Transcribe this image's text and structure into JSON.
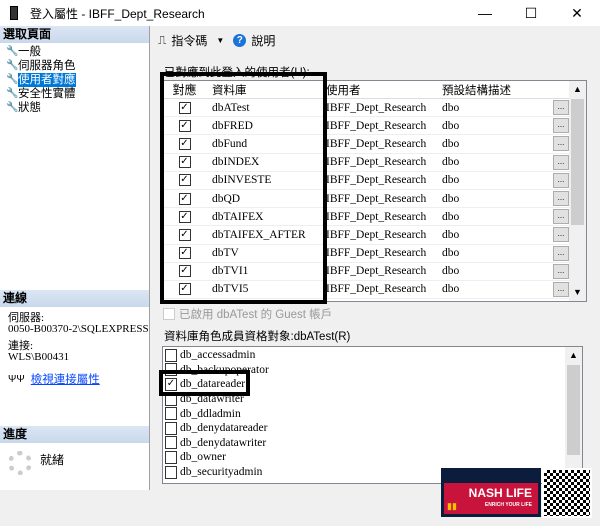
{
  "window": {
    "title": "登入屬性 - IBFF_Dept_Research"
  },
  "left": {
    "select_page_header": "選取頁面",
    "pages": [
      {
        "label": "一般"
      },
      {
        "label": "伺服器角色"
      },
      {
        "label": "使用者對應",
        "selected": true
      },
      {
        "label": "安全性實體"
      },
      {
        "label": "狀態"
      }
    ],
    "connection_header": "連線",
    "server_label": "伺服器:",
    "server_value": "0050-B00370-2\\SQLEXPRESS",
    "connection_label": "連接:",
    "connection_value": "WLS\\B00431",
    "view_connection_link": "檢視連接屬性",
    "progress_header": "進度",
    "progress_status": "就緒"
  },
  "toolbar": {
    "script_label": "指令碼",
    "help_label": "說明"
  },
  "users_mapped": {
    "label": "已對應到此登入的使用者(U):",
    "columns": [
      "對應",
      "資料庫",
      "使用者",
      "預設結構描述"
    ],
    "rows": [
      {
        "map": true,
        "db": "dbATest",
        "user": "IBFF_Dept_Research",
        "schema": "dbo"
      },
      {
        "map": true,
        "db": "dbFRED",
        "user": "IBFF_Dept_Research",
        "schema": "dbo"
      },
      {
        "map": true,
        "db": "dbFund",
        "user": "IBFF_Dept_Research",
        "schema": "dbo"
      },
      {
        "map": true,
        "db": "dbINDEX",
        "user": "IBFF_Dept_Research",
        "schema": "dbo"
      },
      {
        "map": true,
        "db": "dbINVESTE",
        "user": "IBFF_Dept_Research",
        "schema": "dbo"
      },
      {
        "map": true,
        "db": "dbQD",
        "user": "IBFF_Dept_Research",
        "schema": "dbo"
      },
      {
        "map": true,
        "db": "dbTAIFEX",
        "user": "IBFF_Dept_Research",
        "schema": "dbo"
      },
      {
        "map": true,
        "db": "dbTAIFEX_AFTER",
        "user": "IBFF_Dept_Research",
        "schema": "dbo"
      },
      {
        "map": true,
        "db": "dbTV",
        "user": "IBFF_Dept_Research",
        "schema": "dbo"
      },
      {
        "map": true,
        "db": "dbTVI1",
        "user": "IBFF_Dept_Research",
        "schema": "dbo"
      },
      {
        "map": true,
        "db": "dbTVI5",
        "user": "IBFF_Dept_Research",
        "schema": "dbo"
      }
    ],
    "ellipsis": "...",
    "guest_label": "已啟用 dbATest 的 Guest 帳戶"
  },
  "roles": {
    "label": "資料庫角色成員資格對象:dbATest(R)",
    "items": [
      {
        "name": "db_accessadmin",
        "checked": false
      },
      {
        "name": "db_backupoperator",
        "checked": false
      },
      {
        "name": "db_datareader",
        "checked": true
      },
      {
        "name": "db_datawriter",
        "checked": false
      },
      {
        "name": "db_ddladmin",
        "checked": false
      },
      {
        "name": "db_denydatareader",
        "checked": false
      },
      {
        "name": "db_denydatawriter",
        "checked": false
      },
      {
        "name": "db_owner",
        "checked": false
      },
      {
        "name": "db_securityadmin",
        "checked": false
      }
    ]
  },
  "watermark": {
    "title": "NASH LIFE",
    "subtitle": "ENRICH YOUR LIFE"
  }
}
